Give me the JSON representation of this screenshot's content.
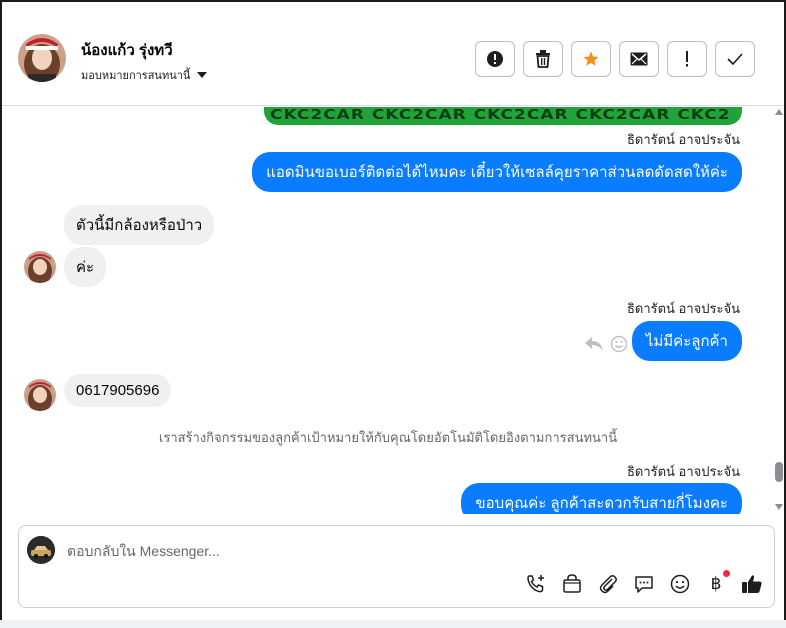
{
  "header": {
    "contact_name": "น้องแก้ว รุ่งทวี",
    "assign_label": "มอบหมายการสนทนานี้",
    "actions": [
      {
        "icon": "alert-circle-icon"
      },
      {
        "icon": "trash-icon"
      },
      {
        "icon": "star-icon"
      },
      {
        "icon": "envelope-icon"
      },
      {
        "icon": "exclamation-icon"
      },
      {
        "icon": "check-icon"
      }
    ]
  },
  "thread": {
    "banner_text": "CKC2CAR CKC2CAR CKC2CAR CKC2CAR CKC2",
    "messages": [
      {
        "sender": "ธิดารัตน์ อาจประจัน",
        "text": "แอดมินขอเบอร์ติดต่อได้ไหมคะ เดี๋ยวให้เซลล์คุยราคาส่วนลดดัดสดให้ค่ะ"
      },
      {
        "text": "ตัวนี้มีกล้องหรือป่าว"
      },
      {
        "text": "ค่ะ"
      },
      {
        "sender": "ธิดารัตน์ อาจประจัน",
        "text": "ไม่มีค่ะลูกค้า"
      },
      {
        "text": "0617905696"
      },
      {
        "system_note": "เราสร้างกิจกรรมของลูกค้าเป้าหมายให้กับคุณโดยอัตโนมัติโดยอิงตามการสนทนานี้"
      },
      {
        "sender": "ธิดารัตน์ อาจประจัน",
        "text": "ขอบคุณค่ะ ลูกค้าสะดวกรับสายกี่โมงคะ"
      }
    ]
  },
  "composer": {
    "placeholder": "ตอบกลับใน Messenger...",
    "tools": [
      "phone-add-icon",
      "shopping-bag-icon",
      "paperclip-icon",
      "chat-bubble-icon",
      "smiley-icon",
      "baht-icon",
      "thumbs-up-icon"
    ],
    "baht_symbol": "฿"
  },
  "colors": {
    "outgoing_bubble": "#0a7cff",
    "incoming_bubble": "#f0f0f0",
    "star": "#f5901f",
    "notification_dot": "#f02849"
  }
}
